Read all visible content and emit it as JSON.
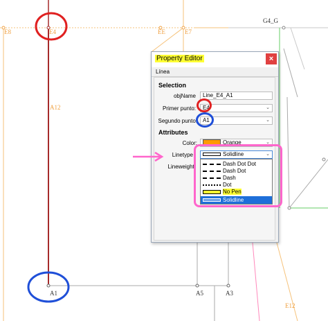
{
  "canvas": {
    "labels": {
      "e8": "E8",
      "e4": "E4",
      "ee": "EE",
      "e7": "E7",
      "g4g": "G4_G",
      "a12": "A12",
      "a1": "A1",
      "a5": "A5",
      "a3": "A3",
      "e12": "E12"
    }
  },
  "dialog": {
    "title": "Property Editor",
    "close": "×",
    "tab": "Línea",
    "selection_header": "Selection",
    "fields": {
      "objname_label": "objName",
      "objname_value": "Line_E4_A1",
      "primer_label": "Primer punto:",
      "primer_value": "E4",
      "segundo_label": "Segundo punto:",
      "segundo_value": "A1"
    },
    "attributes_header": "Attributes",
    "color_label": "Color:",
    "color_value": "Orange",
    "color_swatch": "#ff9900",
    "linetype_label": "Linetype",
    "linetype_value": "Solidline",
    "lineweight_label": "Lineweight:",
    "linetype_options": [
      {
        "label": "Dash Dot Dot"
      },
      {
        "label": "Dash Dot"
      },
      {
        "label": "Dash"
      },
      {
        "label": "Dot"
      },
      {
        "label": "No Pen"
      },
      {
        "label": "Solidline"
      }
    ]
  },
  "colors": {
    "highlight_yellow": "#ffff33",
    "annotation_red": "#e02020",
    "annotation_blue": "#1f4fd8",
    "annotation_pink": "#ff66cc",
    "selected_blue": "#1e6fd9"
  }
}
